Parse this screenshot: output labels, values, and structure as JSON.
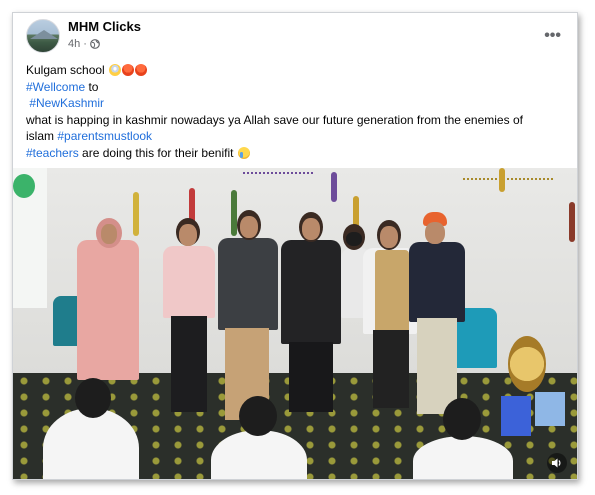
{
  "post": {
    "poster_name": "MHM Clicks",
    "time": "4h",
    "privacy_icon": "globe-icon",
    "more_icon": "more-options-icon",
    "more_label": "•••"
  },
  "caption": {
    "line1": "Kulgam school",
    "line2_tag": "#Wellcome",
    "line2_rest": " to",
    "line3_tag": "#NewKashmir",
    "line4": "what is happing in kashmir nowadays ya Allah save our future generation from the enemies of",
    "line5_text": "islam ",
    "line5_tag": "#parentsmustlook",
    "line6_tag": "#teachers",
    "line6_rest": " are doing this for their benifit",
    "emojis_line1": [
      "face-screaming-emoji",
      "angry-face-emoji",
      "angry-face-emoji"
    ],
    "emoji_line6": "crying-face-emoji"
  },
  "media": {
    "type": "video",
    "volume_icon": "volume-icon"
  },
  "colors": {
    "link": "#216fdb",
    "text": "#050505",
    "secondary": "#65676b"
  }
}
